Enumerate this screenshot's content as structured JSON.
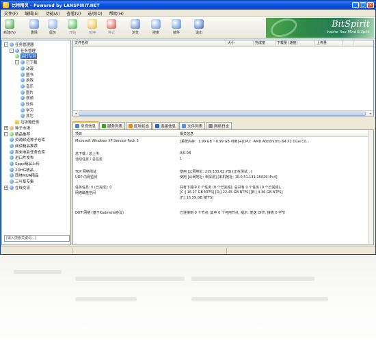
{
  "window": {
    "title": "比特精灵 - Powered by LANSPIRIT.NET"
  },
  "window_buttons": [
    "_",
    "□",
    "×"
  ],
  "menu": [
    "文件(F)",
    "编辑(E)",
    "功能(A)",
    "查看(V)",
    "选项(O)",
    "帮助(H)"
  ],
  "toolbar": [
    {
      "label": "新建(N)",
      "icon": "new-task-icon",
      "color": "#3c9b3a",
      "dim": false
    },
    {
      "label": "删除",
      "icon": "delete-icon",
      "color": "#5a84d6",
      "dim": false
    },
    {
      "label": "属性",
      "icon": "properties-icon",
      "color": "#7b9fe0",
      "dim": false
    },
    {
      "label": "开始",
      "icon": "start-icon",
      "color": "#3bb33b",
      "dim": true
    },
    {
      "label": "暂停",
      "icon": "pause-icon",
      "color": "#f0b21c",
      "dim": true
    },
    {
      "label": "停止",
      "icon": "stop-icon",
      "color": "#e0453a",
      "dim": true
    },
    {
      "label": "浏览",
      "icon": "browse-icon",
      "color": "#4f74c8",
      "dim": false
    },
    {
      "label": "搜索",
      "icon": "search-icon",
      "color": "#5f8fd8",
      "dim": false
    },
    {
      "label": "插件",
      "icon": "plugin-icon",
      "color": "#4a86c8",
      "dim": false
    },
    {
      "label": "退出",
      "icon": "exit-icon",
      "color": "#2f62c8",
      "dim": false
    }
  ],
  "banner": {
    "brand": "BitSpirit",
    "slogan": "Inspire Your Mind & Spirit"
  },
  "tree": [
    {
      "label": "任务管理器",
      "indent": 0,
      "expander": "-",
      "icon": "ic-blue"
    },
    {
      "label": "任务管理",
      "indent": 1,
      "expander": "-",
      "icon": "ic-blue"
    },
    {
      "label": "运行队列",
      "indent": 2,
      "expander": "",
      "icon": "ic-green",
      "selected": true
    },
    {
      "label": "已下载",
      "indent": 2,
      "expander": "-",
      "icon": "ic-blue"
    },
    {
      "label": "动漫",
      "indent": 3,
      "expander": "",
      "icon": "ic-blue"
    },
    {
      "label": "图书",
      "indent": 3,
      "expander": "",
      "icon": "ic-blue"
    },
    {
      "label": "游戏",
      "indent": 3,
      "expander": "",
      "icon": "ic-blue"
    },
    {
      "label": "音乐",
      "indent": 3,
      "expander": "",
      "icon": "ic-blue"
    },
    {
      "label": "图片",
      "indent": 3,
      "expander": "",
      "icon": "ic-blue"
    },
    {
      "label": "视频",
      "indent": 3,
      "expander": "",
      "icon": "ic-blue"
    },
    {
      "label": "软件",
      "indent": 3,
      "expander": "",
      "icon": "ic-blue"
    },
    {
      "label": "学习",
      "indent": 3,
      "expander": "",
      "icon": "ic-blue"
    },
    {
      "label": "其它",
      "indent": 3,
      "expander": "",
      "icon": "ic-blue"
    },
    {
      "label": "垃圾箱任务",
      "indent": 2,
      "expander": "",
      "icon": "ic-folder"
    },
    {
      "label": "种子市场",
      "indent": 0,
      "expander": "+",
      "icon": "ic-orange"
    },
    {
      "label": "精品推荐",
      "indent": 0,
      "expander": "-",
      "icon": "ic-green"
    },
    {
      "label": "资源频道种子仓库",
      "indent": 1,
      "expander": "",
      "icon": "ic-blue"
    },
    {
      "label": "阅读精品推荐",
      "indent": 1,
      "expander": "",
      "icon": "ic-blue"
    },
    {
      "label": "周末电影任务仓库",
      "indent": 1,
      "expander": "",
      "icon": "ic-blue"
    },
    {
      "label": "进口片发布",
      "indent": 1,
      "expander": "",
      "icon": "ic-blue"
    },
    {
      "label": "Sapp精品上传",
      "indent": 1,
      "expander": "",
      "icon": "ic-blue"
    },
    {
      "label": "2DHG精品",
      "indent": 1,
      "expander": "",
      "icon": "ic-blue"
    },
    {
      "label": "西林MUA精品",
      "indent": 1,
      "expander": "",
      "icon": "ic-blue"
    },
    {
      "label": "三叶草专集",
      "indent": 1,
      "expander": "",
      "icon": "ic-blue"
    },
    {
      "label": "在线交流",
      "indent": 0,
      "expander": "+",
      "icon": "ic-blue"
    }
  ],
  "tree_search": {
    "placeholder": "[输入搜索关键词...]"
  },
  "tasklist": {
    "columns": [
      {
        "label": "文件名称",
        "w": 224
      },
      {
        "label": "大小",
        "w": 40
      },
      {
        "label": "完成度",
        "w": 32
      },
      {
        "label": "下载量 (速度)",
        "w": 58
      },
      {
        "label": "上传量",
        "w": 40
      },
      {
        "label": "",
        "w": 16
      },
      {
        "label": "",
        "w": 30
      }
    ]
  },
  "tabs": [
    {
      "label": "常规信息",
      "active": true,
      "color": "#4a86c8"
    },
    {
      "label": "服务列表",
      "active": false,
      "color": "#3aa52e"
    },
    {
      "label": "区块状态",
      "active": false,
      "color": "#e08a10"
    },
    {
      "label": "连接信息",
      "active": false,
      "color": "#2f62c8"
    },
    {
      "label": "文件列表",
      "active": false,
      "color": "#5f8fd8"
    },
    {
      "label": "网络日志",
      "active": false,
      "color": "#888888"
    }
  ],
  "details": {
    "header": {
      "left": "项目",
      "right": "相关信息"
    },
    "rows": [
      {
        "left": "Microsoft Windows XP Service Pack 3",
        "right": "[系统内存：1.99 GB ~0.99 GB 可用]+[CPU：AMD Athlon(tm) 64 X2 Dual Co..."
      },
      {
        "left": "总下载 / 总上传",
        "right": "0/0.0B"
      },
      {
        "left": "活动任务 / 总任务",
        "right": "1"
      },
      {
        "left": "TCP 网络测试",
        "right": "使用 [公网地址: 219.133.62.78] [正在测试...]"
      },
      {
        "left": "UDP 内网监测",
        "right": "使用 [公网地址: 未探测] [本机地址: 10.0.51.131:15629 IPv4]"
      },
      {
        "left": "任务信息: 0 (已完成): 0",
        "right": "共有下载中 0 个任务 (0 个已完成), 总共有 0 个任务 (0 个已完成)。"
      },
      {
        "left": "网络磁盘空间",
        "right": "[C:] 16.27 GB  NTFS] [D:] 22.45 GB  NTFS] [E:] 4.36 GB  NTFS]"
      },
      {
        "left": "",
        "right": "[F:] 16.59 GB  NTFS]"
      },
      {
        "left": "DHT 网络 (基于Kadmelia协议)",
        "right": "已连接到 0 个节点, 其中 0 个可用节点, 提示: 发送 DHT, 接收 0 字节"
      }
    ]
  }
}
